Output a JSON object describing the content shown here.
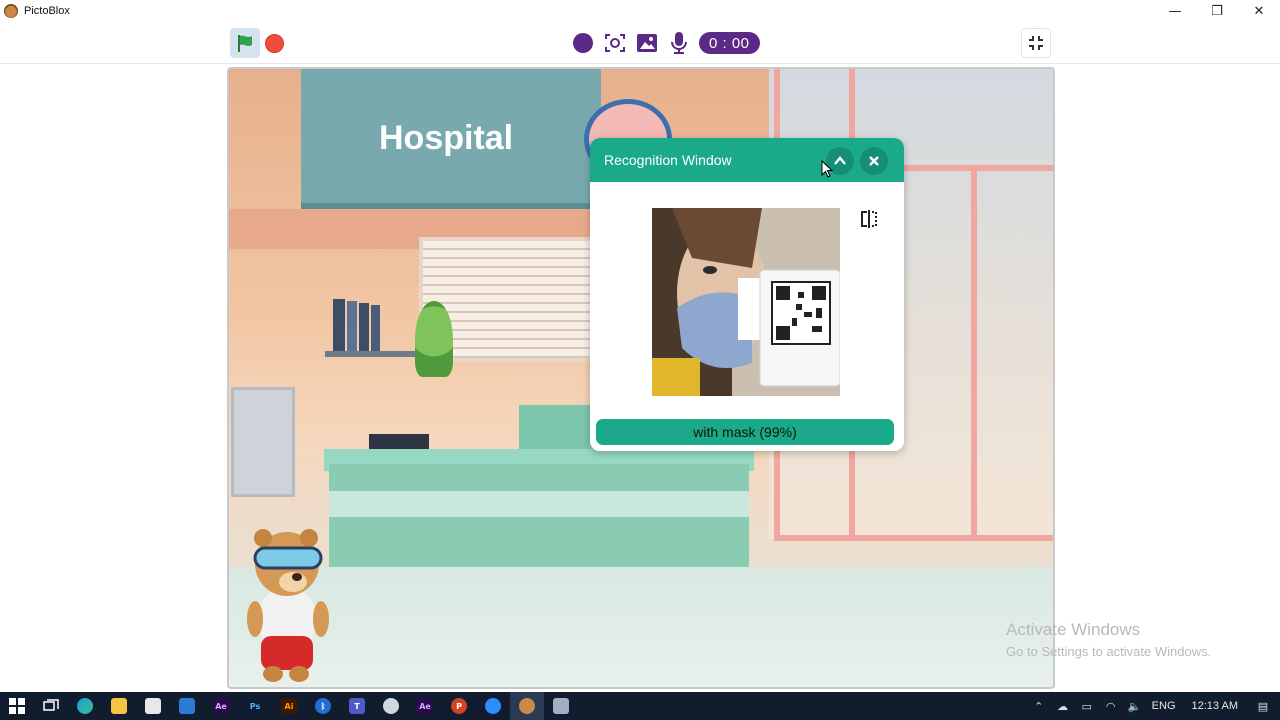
{
  "app": {
    "title": "PictoBlox"
  },
  "window_controls": {
    "minimize": "—",
    "restore": "❐",
    "close": "✕"
  },
  "toolbar": {
    "timer": "0 : 00"
  },
  "stage": {
    "sign_text": "Hospital"
  },
  "recognition_window": {
    "title": "Recognition Window",
    "result": "with mask (99%)"
  },
  "watermark": {
    "title": "Activate Windows",
    "subtitle": "Go to Settings to activate Windows."
  },
  "taskbar": {
    "apps": [
      "start",
      "task-view",
      "edge",
      "file-explorer",
      "store",
      "mail",
      "adobe-ae",
      "photoshop",
      "illustrator",
      "bluetooth",
      "teams",
      "app",
      "adobe-ae-2",
      "powerpoint",
      "zoom",
      "pictoblox",
      "app-2"
    ],
    "tray": {
      "language": "ENG",
      "time": "12:13 AM"
    }
  },
  "colors": {
    "accent": "#1aaa8a",
    "timer_bg": "#5b2a86",
    "stop": "#f24b3c",
    "flag": "#2fa34a"
  }
}
